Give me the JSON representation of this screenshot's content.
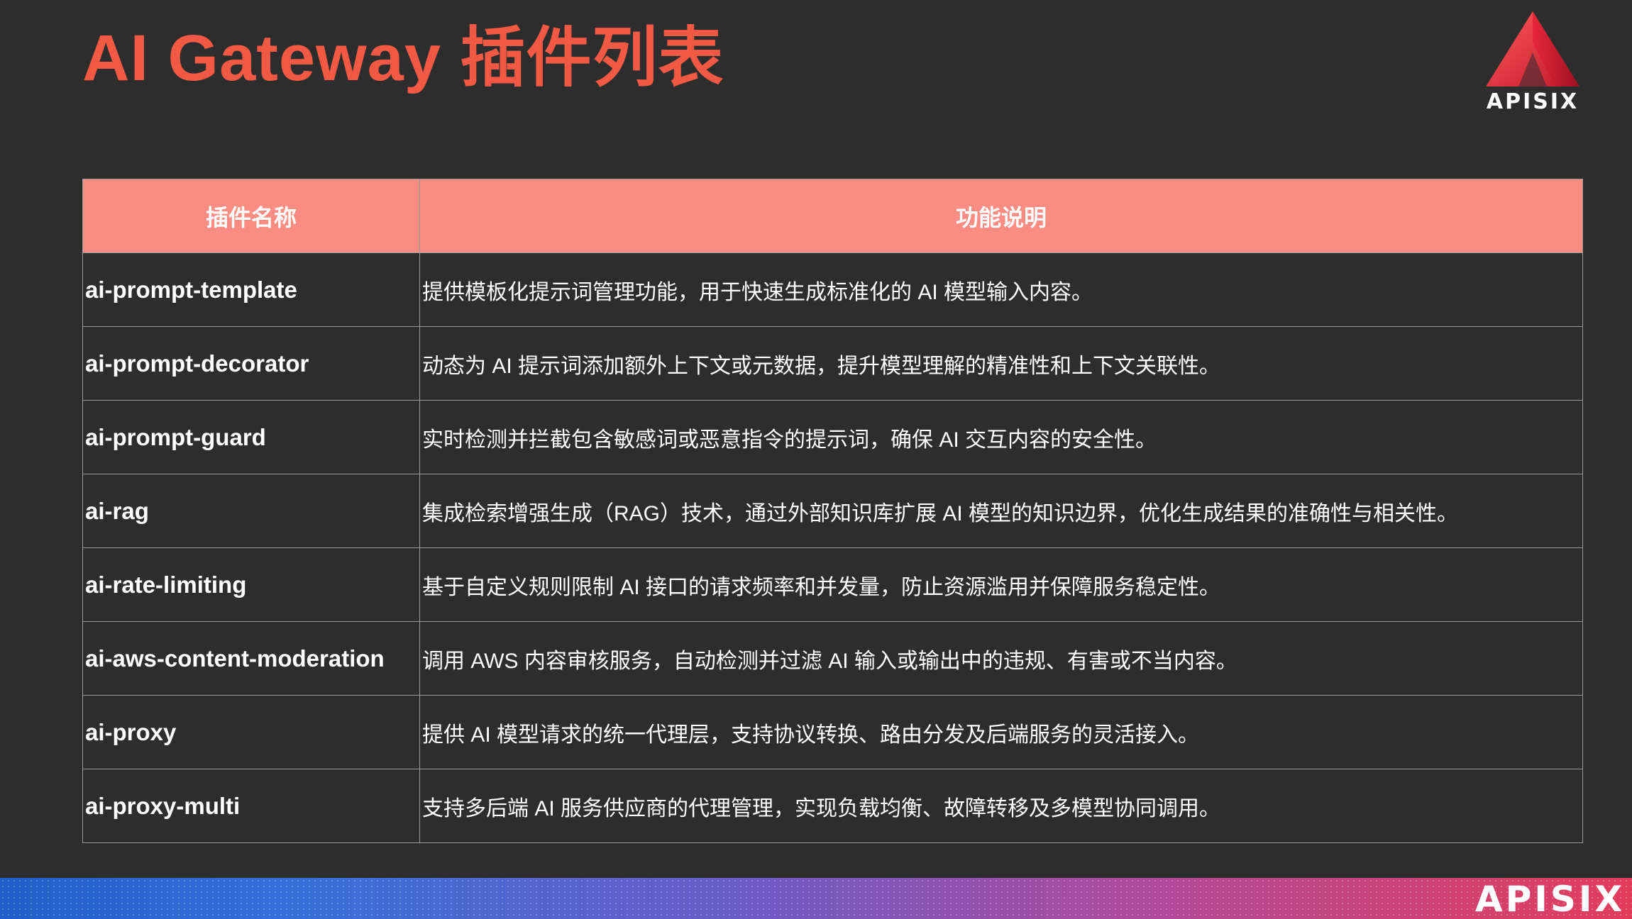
{
  "title": "AI Gateway 插件列表",
  "logo": {
    "text": "APISIX",
    "icon": "apisix-triangle-logo"
  },
  "table": {
    "headers": [
      "插件名称",
      "功能说明"
    ],
    "rows": [
      {
        "name": "ai-prompt-template",
        "desc": "提供模板化提示词管理功能，用于快速生成标准化的 AI 模型输入内容。"
      },
      {
        "name": "ai-prompt-decorator",
        "desc": "动态为 AI 提示词添加额外上下文或元数据，提升模型理解的精准性和上下文关联性。"
      },
      {
        "name": "ai-prompt-guard",
        "desc": "实时检测并拦截包含敏感词或恶意指令的提示词，确保 AI 交互内容的安全性。"
      },
      {
        "name": "ai-rag",
        "desc": "集成检索增强生成（RAG）技术，通过外部知识库扩展 AI 模型的知识边界，优化生成结果的准确性与相关性。"
      },
      {
        "name": "ai-rate-limiting",
        "desc": "基于自定义规则限制 AI 接口的请求频率和并发量，防止资源滥用并保障服务稳定性。"
      },
      {
        "name": "ai-aws-content-moderation",
        "desc": "调用 AWS 内容审核服务，自动检测并过滤 AI 输入或输出中的违规、有害或不当内容。"
      },
      {
        "name": "ai-proxy",
        "desc": "提供 AI 模型请求的统一代理层，支持协议转换、路由分发及后端服务的灵活接入。"
      },
      {
        "name": "ai-proxy-multi",
        "desc": "支持多后端 AI 服务供应商的代理管理，实现负载均衡、故障转移及多模型协同调用。"
      }
    ]
  },
  "footer": {
    "logo_text": "APISIX"
  },
  "colors": {
    "title": "#f25944",
    "header_bg": "#fb8c82",
    "background": "#2d2d2d",
    "logo_red": "#e8283a"
  }
}
